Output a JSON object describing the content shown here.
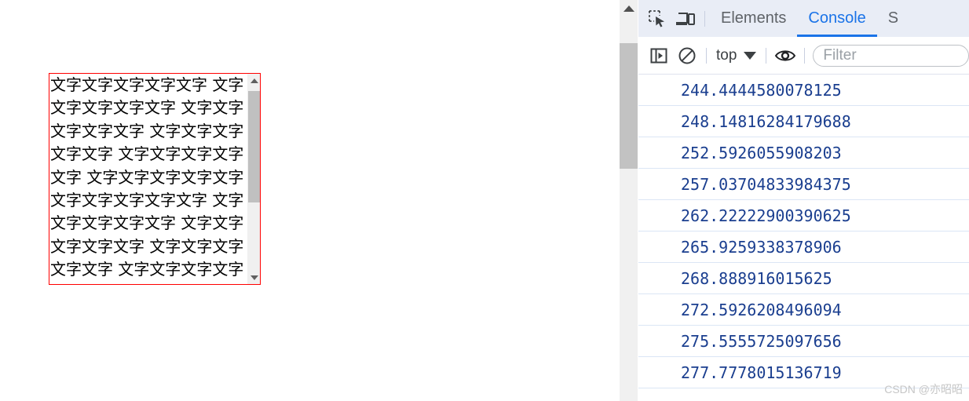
{
  "page": {
    "textbox": {
      "content": "文字文字文字文字文字 文字文字文字文字文字 文字文字文字文字文字 文字文字文字文字文字 文字文字文字文字文字 文字文字文字文字文字 文字文字文字文字文字 文字文字文字文字文字 文字文字文字文字文字 文字文字文字文字文字 文字文字文字文字文字 文字文字文字文字文字",
      "border_color": "#ff0000",
      "scrollbar": {
        "up_arrow_icon": "triangle-up-icon",
        "down_arrow_icon": "triangle-down-icon",
        "thumb_color": "#c0c0c0"
      }
    },
    "scrollbar": {
      "up_arrow_icon": "triangle-up-icon",
      "thumb_color": "#c2c2c2"
    }
  },
  "devtools": {
    "accent_color": "#1a73e8",
    "tabbar": {
      "inspect_icon": "inspect-element-icon",
      "device_icon": "device-toolbar-icon",
      "tabs": [
        {
          "label": "Elements",
          "active": false
        },
        {
          "label": "Console",
          "active": true
        },
        {
          "label": "S",
          "active": false
        }
      ]
    },
    "toolbar": {
      "sidebar_icon": "console-sidebar-icon",
      "clear_icon": "clear-console-icon",
      "context_label": "top",
      "caret_icon": "chevron-down-icon",
      "eye_icon": "live-expression-eye-icon",
      "filter_placeholder": "Filter",
      "filter_value": ""
    },
    "console_rows": [
      "244.4444580078125",
      "248.14816284179688",
      "252.5926055908203",
      "257.03704833984375",
      "262.22222900390625",
      "265.9259338378906",
      "268.888916015625",
      "272.5926208496094",
      "275.5555725097656",
      "277.7778015136719"
    ]
  },
  "watermark": {
    "text": "CSDN @亦昭昭"
  }
}
